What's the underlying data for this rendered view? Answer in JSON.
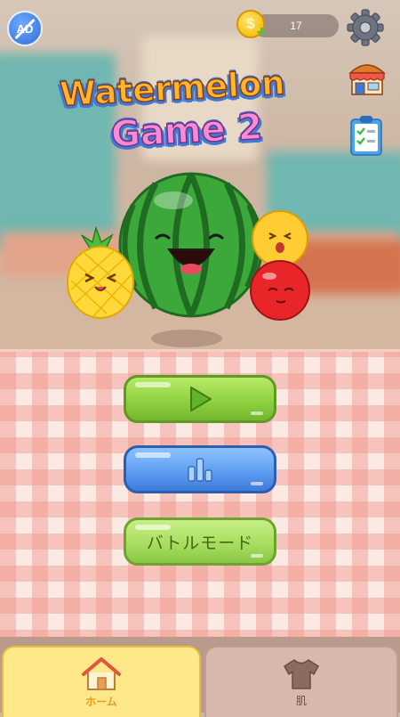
{
  "header": {
    "ad_label": "AD",
    "coins": "17",
    "coin_symbol": "$",
    "coin_add": "+"
  },
  "title": {
    "line1": "Watermelon",
    "line2": "Game 2"
  },
  "menu": {
    "play_icon": "play-triangle-icon",
    "ranking_icon": "bar-chart-icon",
    "battle_label": "バトルモード"
  },
  "nav": {
    "home_label": "ホーム",
    "skin_label": "肌"
  },
  "colors": {
    "play_button": "#8ccf3e",
    "ranking_button": "#5a9af0",
    "battle_button": "#a5dc5d",
    "home_tab": "#ffe88a",
    "skin_tab": "#d8b8ae"
  }
}
